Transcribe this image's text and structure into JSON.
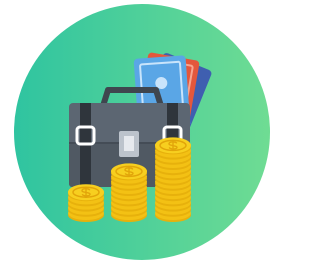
{
  "illustration": {
    "subject": "money-briefcase-coins",
    "colors": {
      "circle_start": "#2fc4a0",
      "circle_end": "#6fdc93",
      "briefcase_body": "#5c6672",
      "briefcase_dark": "#444c56",
      "briefcase_handle": "#3f464f",
      "strap": "#2f353c",
      "lock_plate": "#bcc3cc",
      "banknote_blue": "#5aa6e6",
      "banknote_red": "#e4573c",
      "banknote_navy": "#3f5fb0",
      "coin_gold": "#f7cf1f",
      "coin_shade": "#e7b10c",
      "coin_edge": "#f3c114",
      "coin_symbol": "#e2a50a"
    },
    "icons": [
      "briefcase-icon",
      "banknote-icon",
      "coin-stack-icon",
      "dollar-coin-icon"
    ]
  }
}
